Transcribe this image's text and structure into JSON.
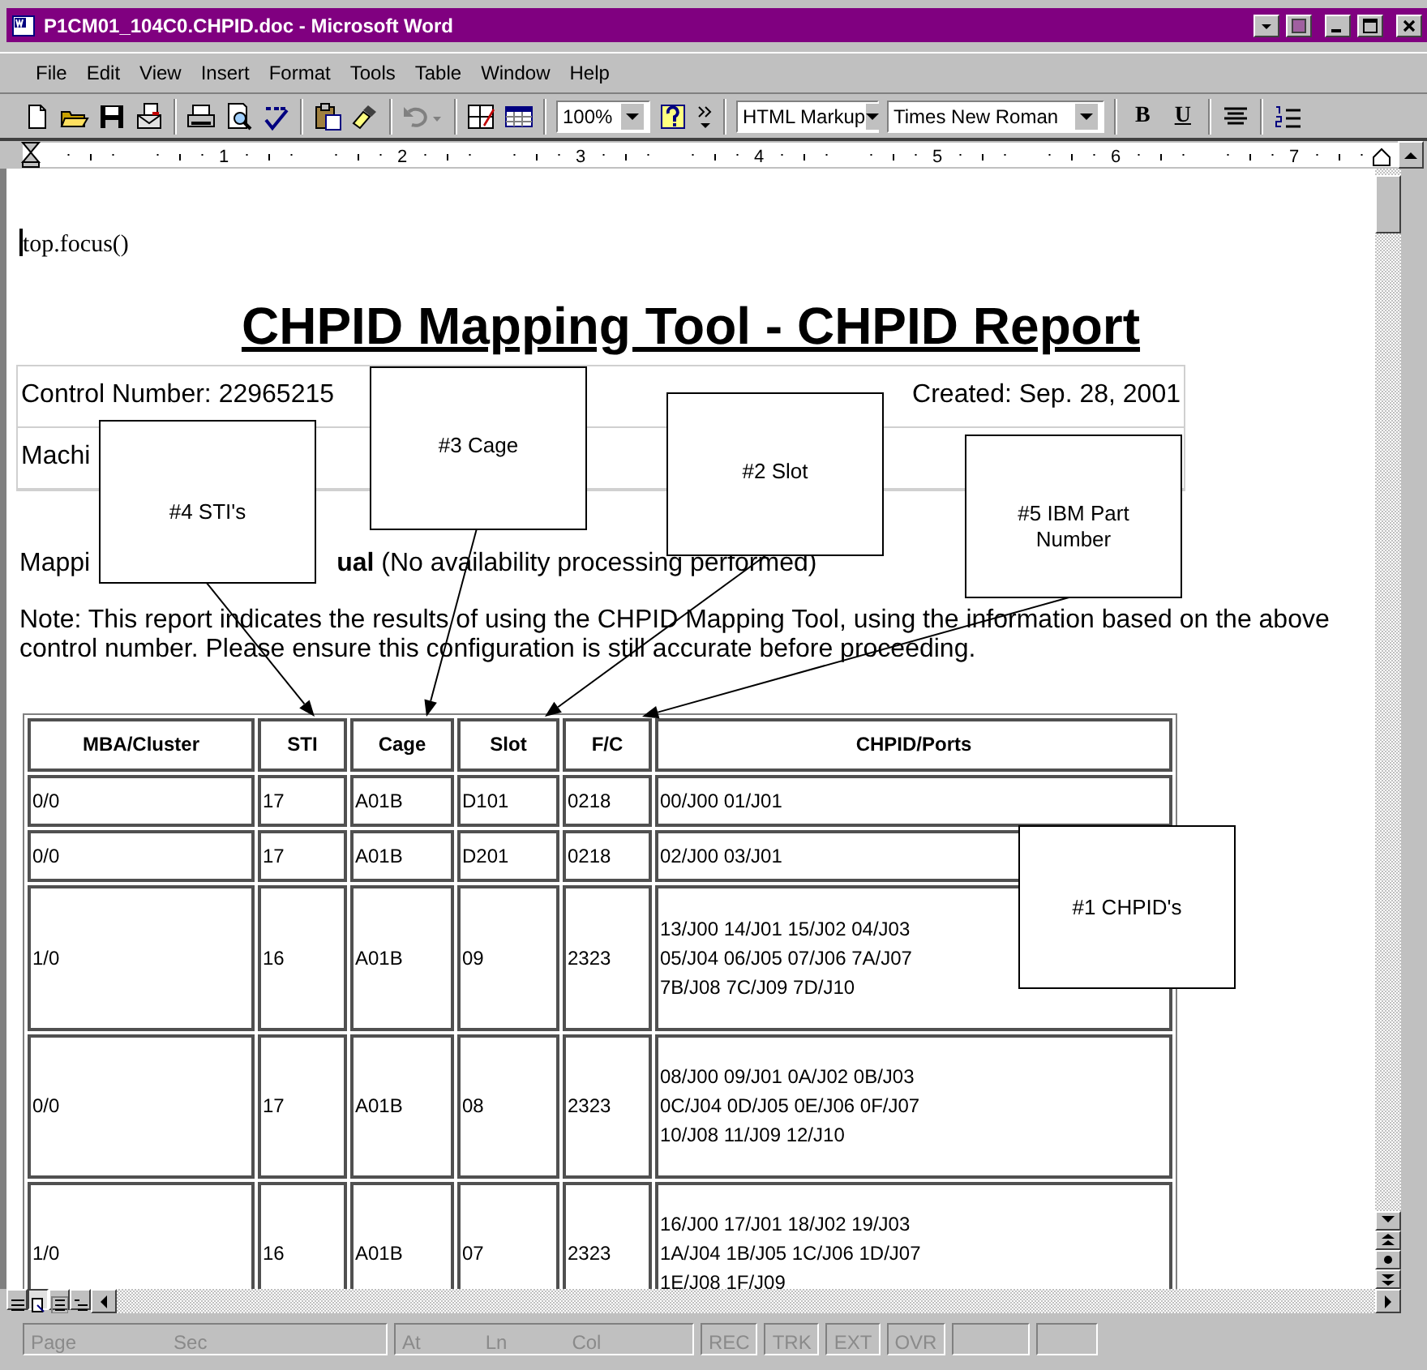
{
  "window": {
    "title": "P1CM01_104C0.CHPID.doc - Microsoft Word"
  },
  "menu": [
    {
      "label": "File"
    },
    {
      "label": "Edit"
    },
    {
      "label": "View"
    },
    {
      "label": "Insert"
    },
    {
      "label": "Format"
    },
    {
      "label": "Tools"
    },
    {
      "label": "Table"
    },
    {
      "label": "Window"
    },
    {
      "label": "Help"
    }
  ],
  "toolbar": {
    "undo_disabled": true,
    "zoom": "100%",
    "style": "HTML Markup",
    "font": "Times New Roman",
    "bold_label": "B",
    "underline_label": "U"
  },
  "ruler": {
    "labels": [
      "1",
      "2",
      "3",
      "4",
      "5",
      "6",
      "7"
    ]
  },
  "document": {
    "script_line": "top.focus()",
    "heading": "CHPID Mapping Tool - CHPID Report",
    "info_rows": [
      [
        "Control Number: 22965215",
        "Created: Sep. 28, 2001"
      ],
      [
        "Machi"
      ]
    ],
    "mapping_line": {
      "start": "Mappi",
      "end": "**ual** (No availability processing performed)"
    },
    "note": "Note: This report indicates the results of using the CHPID Mapping Tool, using the information based on the above control number. Please ensure this configuration is still accurate before proceeding.",
    "table": {
      "columns": [
        "MBA/Cluster",
        "STI",
        "Cage",
        "Slot",
        "F/C",
        "CHPID/Ports"
      ],
      "rows": [
        [
          "0/0",
          "17",
          "A01B",
          "D101",
          "0218",
          "00/J00 01/J01"
        ],
        [
          "0/0",
          "17",
          "A01B",
          "D201",
          "0218",
          "02/J00 03/J01"
        ],
        [
          "1/0",
          "16",
          "A01B",
          "09",
          "2323",
          "13/J00 14/J01 15/J02 04/J03\n05/J04 06/J05 07/J06 7A/J07\n7B/J08 7C/J09 7D/J10"
        ],
        [
          "0/0",
          "17",
          "A01B",
          "08",
          "2323",
          "08/J00 09/J01 0A/J02 0B/J03\n0C/J04 0D/J05 0E/J06 0F/J07\n10/J08 11/J09 12/J10"
        ],
        [
          "1/0",
          "16",
          "A01B",
          "07",
          "2323",
          "16/J00 17/J01 18/J02 19/J03\n1A/J04 1B/J05 1C/J06 1D/J07\n1E/J08 1F/J09"
        ]
      ]
    },
    "callouts": [
      {
        "label": "#4 STI's"
      },
      {
        "label": "#3 Cage"
      },
      {
        "label": "#2 Slot"
      },
      {
        "label": "#5 IBM Part Number"
      },
      {
        "label": "#1 CHPID's"
      }
    ]
  },
  "view_buttons": [
    {
      "selected": false
    },
    {
      "selected": true
    },
    {
      "selected": false
    },
    {
      "selected": false
    }
  ],
  "status_bar": [
    {
      "label": "Page",
      "dimmed": true
    },
    {
      "label": "Sec",
      "dimmed": true
    },
    {
      "label": "At",
      "dimmed": true
    },
    {
      "label": "Ln",
      "dimmed": true
    },
    {
      "label": "Col",
      "dimmed": true
    },
    {
      "label": "REC",
      "dimmed": true
    },
    {
      "label": "TRK",
      "dimmed": true
    },
    {
      "label": "EXT",
      "dimmed": true
    },
    {
      "label": "OVR",
      "dimmed": true
    }
  ]
}
